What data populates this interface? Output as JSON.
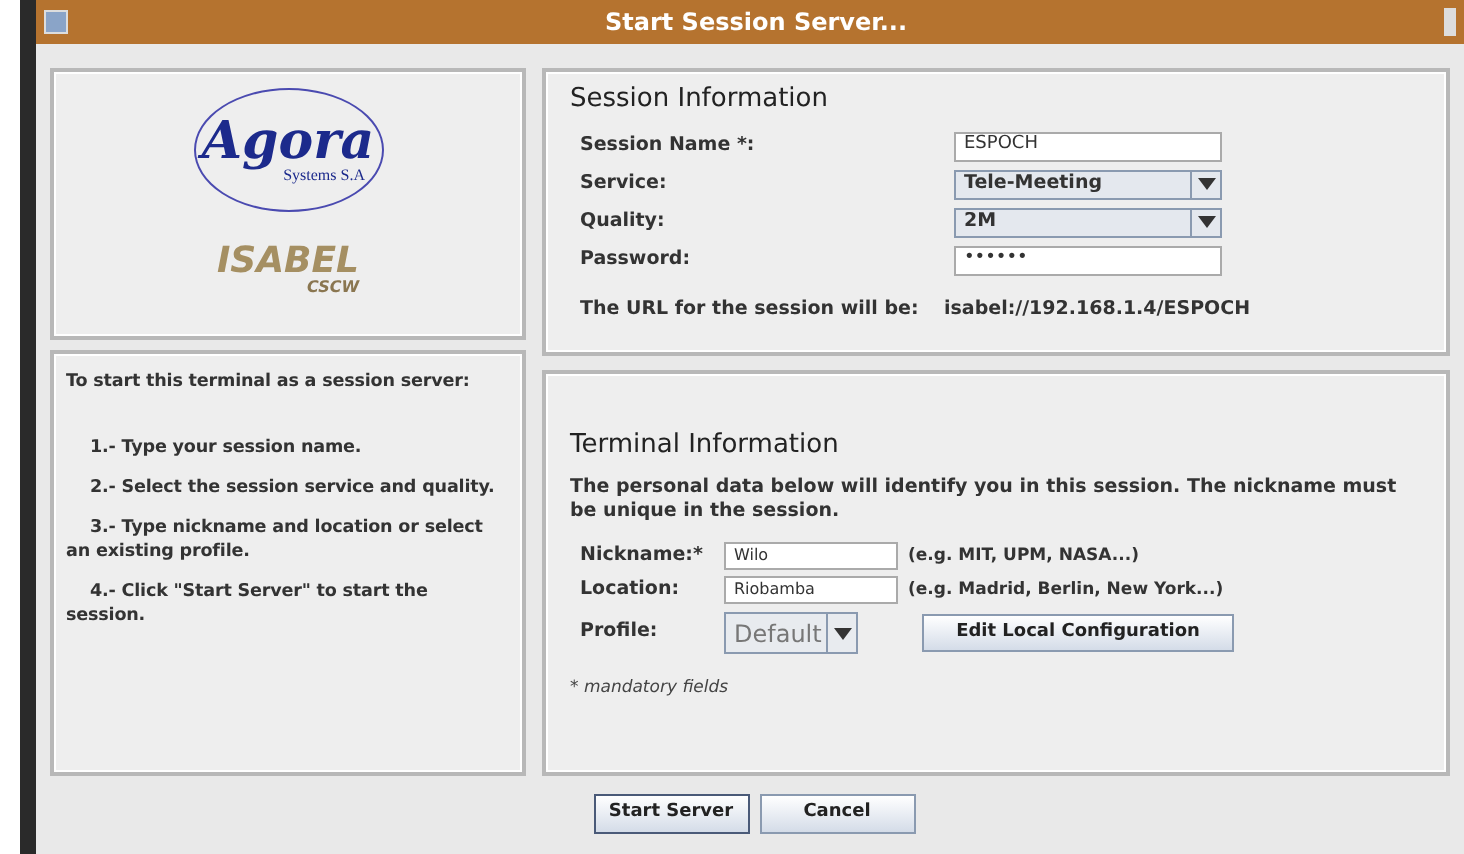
{
  "window": {
    "title": "Start Session Server..."
  },
  "logos": {
    "agora": "Agora",
    "agora_sub": "Systems S.A",
    "isabel": "ISABEL",
    "isabel_sub": "CSCW"
  },
  "instructions": {
    "heading": "To start this terminal as a session server:",
    "steps": [
      "1.- Type your session name.",
      "2.- Select the session service and quality.",
      "3.- Type nickname and location or select an existing profile.",
      "4.- Click \"Start Server\" to start the session."
    ]
  },
  "session_information": {
    "title": "Session Information",
    "fields": [
      {
        "label": "Session Name *:",
        "kind": "text",
        "value": "ESPOCH"
      },
      {
        "label": "Service:",
        "kind": "select",
        "value": "Tele-Meeting"
      },
      {
        "label": "Quality:",
        "kind": "select",
        "value": "2M"
      },
      {
        "label": "Password:",
        "kind": "password",
        "value": "••••••"
      }
    ],
    "url_label": "The URL for the session will be:",
    "url": "isabel://192.168.1.4/ESPOCH"
  },
  "terminal_information": {
    "title": "Terminal Information",
    "description": "The personal data below will identify you in this session. The nickname must be unique in the session.",
    "nickname": {
      "label": "Nickname:*",
      "value": "Wilo",
      "hint": "(e.g. MIT, UPM, NASA...)"
    },
    "location": {
      "label": "Location:",
      "value": "Riobamba",
      "hint": "(e.g. Madrid, Berlin, New York...)"
    },
    "profile": {
      "label": "Profile:",
      "value": "Default"
    },
    "edit_button": "Edit Local Configuration",
    "note": "* mandatory fields"
  },
  "buttons": [
    "Start Server",
    "Cancel"
  ]
}
